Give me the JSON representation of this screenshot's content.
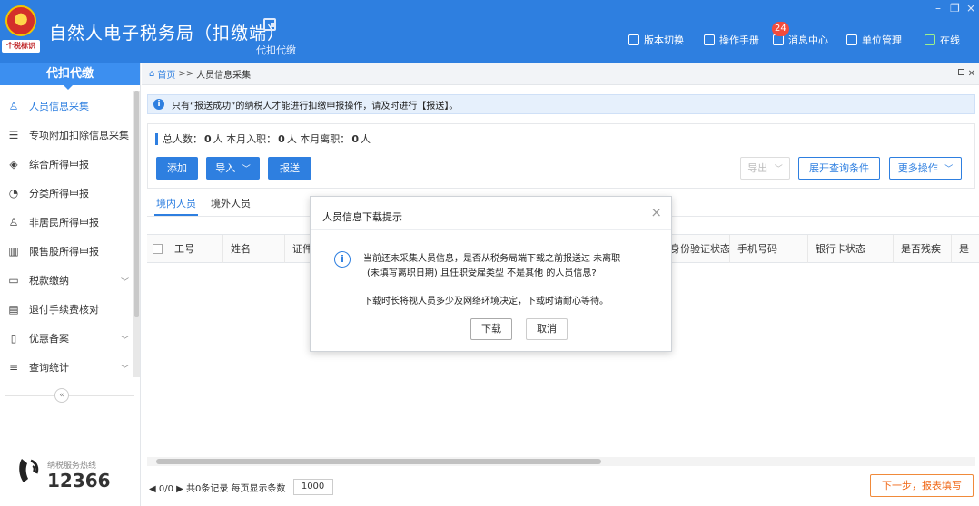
{
  "app": {
    "title": "自然人电子税务局（扣缴端）",
    "emblem_text": "个税标识",
    "menu_label": "代扣代缴"
  },
  "window": {
    "minimize": "–",
    "restore": "❐",
    "close": "×"
  },
  "top_nav": {
    "version_switch": "版本切换",
    "manual": "操作手册",
    "messages": "消息中心",
    "message_count": "24",
    "unit_manage": "单位管理",
    "status": "在线"
  },
  "sidebar": {
    "header": "代扣代缴",
    "items": [
      {
        "label": "人员信息采集",
        "icon": "person-icon"
      },
      {
        "label": "专项附加扣除信息采集",
        "icon": "list-icon"
      },
      {
        "label": "综合所得申报",
        "icon": "layers-icon"
      },
      {
        "label": "分类所得申报",
        "icon": "pie-icon"
      },
      {
        "label": "非居民所得申报",
        "icon": "user-icon"
      },
      {
        "label": "限售股所得申报",
        "icon": "bar-icon"
      },
      {
        "label": "税款缴纳",
        "icon": "folder-icon"
      },
      {
        "label": "退付手续费核对",
        "icon": "doc-icon"
      },
      {
        "label": "优惠备案",
        "icon": "file-icon"
      },
      {
        "label": "查询统计",
        "icon": "search-list-icon"
      }
    ],
    "collapse": "«",
    "hotline_label": "纳税服务热线",
    "hotline_number": "12366"
  },
  "breadcrumb": {
    "home": "首页",
    "sep": ">>",
    "current": "人员信息采集"
  },
  "notice": "只有“报送成功”的纳税人才能进行扣缴申报操作，请及时进行【报送】。",
  "stats": {
    "total_label": "总人数：",
    "total_value": "0",
    "hired_label": "人  本月入职：",
    "hired_value": "0",
    "left_label": "人  本月离职：",
    "left_value": "0",
    "unit": "人"
  },
  "toolbar": {
    "add": "添加",
    "import": "导入",
    "submit": "报送",
    "export": "导出",
    "expand_query": "展开查询条件",
    "more_ops": "更多操作"
  },
  "tabs": [
    "境内人员",
    "境外人员"
  ],
  "table": {
    "columns": [
      "工号",
      "姓名",
      "证件",
      "身份验证状态",
      "手机号码",
      "银行卡状态",
      "是否残疾",
      "是"
    ]
  },
  "pager": {
    "info": "◀ 0/0 ▶ 共0条记录  每页显示条数",
    "page_size": "1000",
    "next": "下一步，报表填写"
  },
  "dialog": {
    "title": "人员信息下载提示",
    "line1": "当前还未采集人员信息，是否从税务局端下载之前报送过 未离职",
    "line2": "(未填写离职日期) 且任职受雇类型 不是其他 的人员信息?",
    "line3": "下载时长将视人员多少及网络环境决定，下载时请耐心等待。",
    "ok": "下载",
    "cancel": "取消"
  }
}
